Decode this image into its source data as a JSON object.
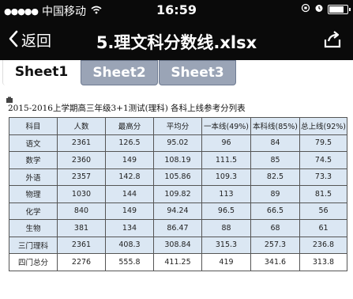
{
  "status": {
    "signal": "●●●●●",
    "carrier": "中国移动",
    "time": "16:59"
  },
  "nav": {
    "back_label": "返回",
    "title": "5.理文科分数线.xlsx"
  },
  "tabs": [
    {
      "label": "Sheet1",
      "active": true
    },
    {
      "label": "Sheet2",
      "active": false
    },
    {
      "label": "Sheet3",
      "active": false
    }
  ],
  "sheet": {
    "title": "2015-2016上学期高三年级3+1测试(理科) 各科上线参考分列表",
    "headers": [
      "科目",
      "人数",
      "最高分",
      "平均分",
      "一本线(49%)",
      "本科线(85%)",
      "总上线(92%)"
    ],
    "rows": [
      [
        "语文",
        "2361",
        "126.5",
        "95.02",
        "96",
        "84",
        "79.5"
      ],
      [
        "数学",
        "2360",
        "149",
        "108.19",
        "111.5",
        "85",
        "74.5"
      ],
      [
        "外语",
        "2357",
        "142.8",
        "105.86",
        "109.3",
        "82.5",
        "73.3"
      ],
      [
        "物理",
        "1030",
        "144",
        "109.82",
        "113",
        "89",
        "81.5"
      ],
      [
        "化学",
        "840",
        "149",
        "94.24",
        "96.5",
        "66.5",
        "56"
      ],
      [
        "生物",
        "381",
        "134",
        "86.47",
        "88",
        "68",
        "61"
      ],
      [
        "三门理科",
        "2361",
        "408.3",
        "308.84",
        "315.3",
        "257.3",
        "236.8"
      ],
      [
        "四门总分",
        "2276",
        "555.8",
        "411.25",
        "419",
        "341.6",
        "313.8"
      ]
    ]
  }
}
